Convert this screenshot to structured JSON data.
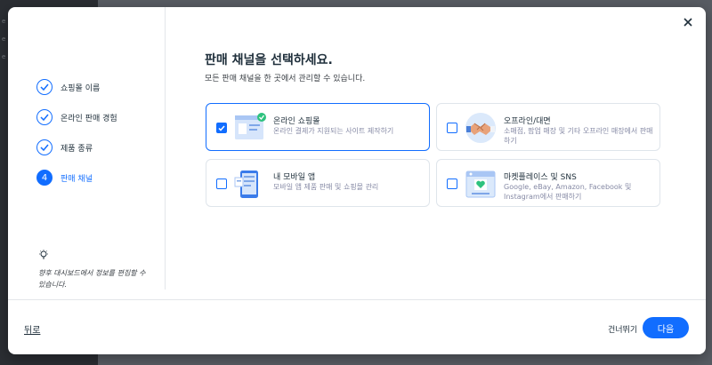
{
  "modal": {
    "title": "판매 채널을 선택하세요.",
    "subtitle": "모든 판매 채널을 한 곳에서 관리할 수 있습니다."
  },
  "steps": [
    {
      "label": "쇼핑몰 이름",
      "state": "done"
    },
    {
      "label": "온라인 판매 경험",
      "state": "done"
    },
    {
      "label": "제품 종류",
      "state": "done"
    },
    {
      "label": "판매 채널",
      "state": "active",
      "number": "4"
    }
  ],
  "tip": {
    "icon": "lightbulb-icon",
    "text": "향후 대시보드에서 정보를 편집할 수 있습니다."
  },
  "channels": [
    {
      "title": "온라인 쇼핑몰",
      "description": "온라인 결제가 지원되는 사이트 제작하기",
      "checked": true,
      "icon": "online-store-illustration"
    },
    {
      "title": "오프라인/대면",
      "description": "소매점, 팝업 매장 및 기타 오프라인 매장에서 판매하기",
      "checked": false,
      "icon": "handshake-illustration"
    },
    {
      "title": "내 모바일 앱",
      "description": "모바일 앱 제품 판매 및 쇼핑몰 관리",
      "checked": false,
      "icon": "mobile-app-illustration"
    },
    {
      "title": "마켓플레이스 및 SNS",
      "description": "Google, eBay, Amazon, Facebook 및 Instagram에서 판매하기",
      "checked": false,
      "icon": "marketplace-illustration"
    }
  ],
  "footer": {
    "back_label": "뒤로",
    "skip_label": "건너뛰기",
    "next_label": "다음"
  },
  "colors": {
    "accent": "#116dff",
    "text": "#20303c",
    "muted": "#868aa5",
    "border": "#dfe5eb"
  }
}
